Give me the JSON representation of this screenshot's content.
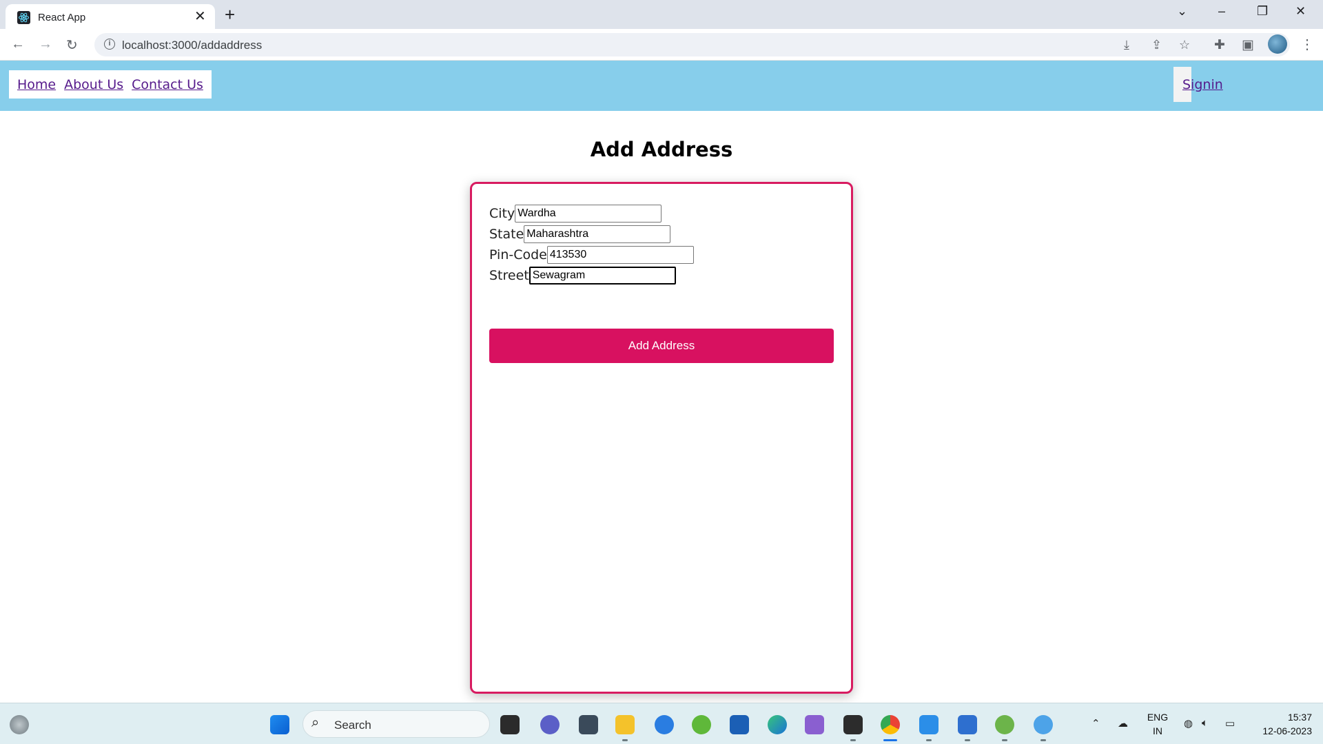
{
  "browser": {
    "tab_title": "React App",
    "url": "localhost:3000/addaddress"
  },
  "site_nav": {
    "links": [
      "Home",
      "About Us",
      "Contact Us"
    ],
    "signin": "Signin",
    "background": "#87ceeb"
  },
  "page": {
    "title": "Add Address"
  },
  "form": {
    "fields": [
      {
        "label": "City",
        "value": "Wardha"
      },
      {
        "label": "State",
        "value": "Maharashtra"
      },
      {
        "label": "Pin-Code",
        "value": "413530"
      },
      {
        "label": "Street",
        "value": "Sewagram"
      }
    ],
    "submit_label": "Add Address",
    "accent_color": "#d81160"
  },
  "taskbar": {
    "search_placeholder": "Search",
    "language": [
      "ENG",
      "IN"
    ],
    "time": "15:37",
    "date": "12-06-2023"
  }
}
